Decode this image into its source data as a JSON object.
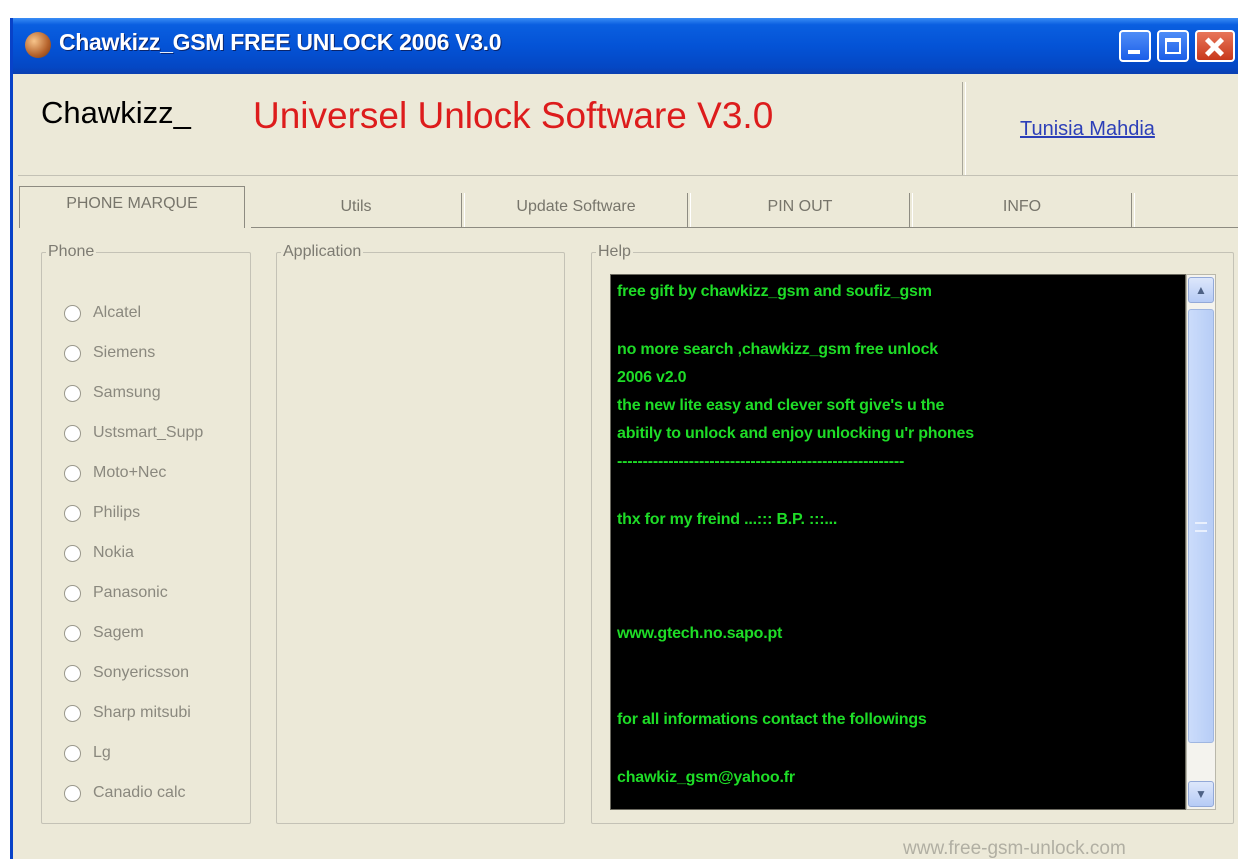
{
  "window": {
    "title": "Chawkizz_GSM FREE UNLOCK 2006 V3.0"
  },
  "header": {
    "brand": "Chawkizz_",
    "tagline": "Universel Unlock Software V3.0",
    "link": "Tunisia Mahdia"
  },
  "tabs": [
    {
      "label": "PHONE MARQUE",
      "active": true
    },
    {
      "label": "Utils",
      "active": false
    },
    {
      "label": "Update Software",
      "active": false
    },
    {
      "label": "PIN OUT",
      "active": false
    },
    {
      "label": "INFO",
      "active": false
    }
  ],
  "phone": {
    "legend": "Phone",
    "options": [
      "Alcatel",
      "Siemens",
      "Samsung",
      "Ustsmart_Supp",
      "Moto+Nec",
      "Philips",
      "Nokia",
      "Panasonic",
      "Sagem",
      "Sonyericsson",
      "Sharp mitsubi",
      "Lg",
      "Canadio calc"
    ]
  },
  "application": {
    "legend": "Application"
  },
  "help": {
    "legend": "Help",
    "lines": [
      "free gift by chawkizz_gsm and soufiz_gsm",
      "no more search ,chawkizz_gsm free unlock",
      "2006 v2.0",
      "the new lite easy and clever soft give's u the",
      " abitily to unlock and enjoy unlocking u'r phones",
      "--------------------------------------------------------",
      "thx for my freind  ...::: B.P. :::...",
      "www.gtech.no.sapo.pt",
      "for all informations contact the followings",
      "chawkiz_gsm@yahoo.fr"
    ]
  },
  "footer": {
    "watermark": "www.free-gsm-unlock.com"
  },
  "colors": {
    "titlebar": "#0453d6",
    "tagline": "#dd1c1c",
    "help_text": "#1edc27",
    "help_bg": "#000000",
    "window_bg": "#ece9d8"
  }
}
